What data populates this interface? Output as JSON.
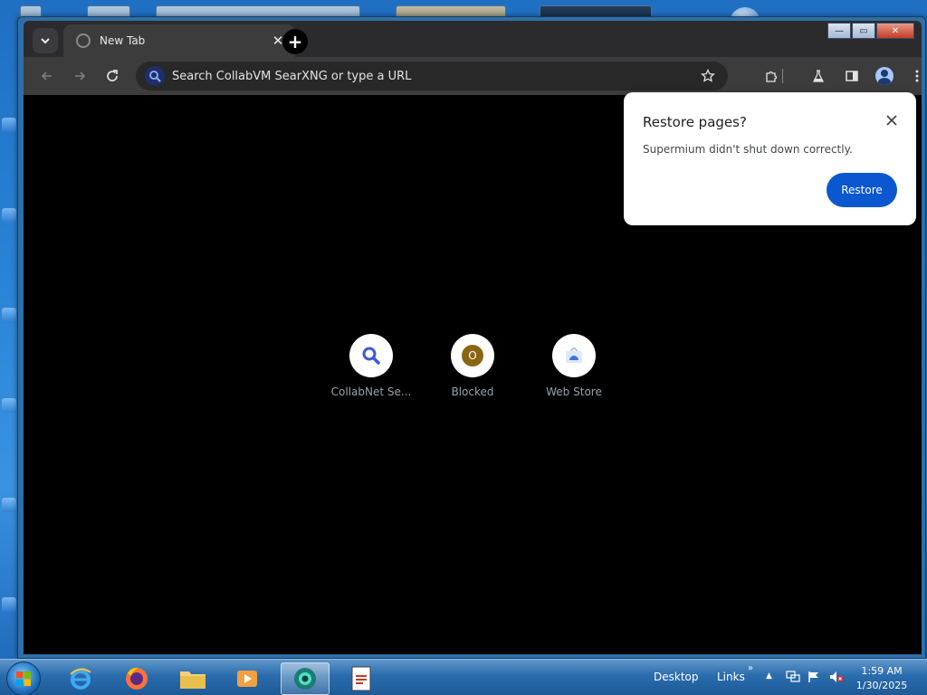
{
  "browser": {
    "tab": {
      "title": "New Tab"
    },
    "omnibox": {
      "placeholder": "Search CollabVM SearXNG or type a URL"
    },
    "shortcuts": [
      {
        "label": "CollabNet Se...",
        "icon": "magnifier-icon"
      },
      {
        "label": "Blocked",
        "icon": "blocked-site-icon",
        "letter": "O"
      },
      {
        "label": "Web Store",
        "icon": "web-store-icon"
      }
    ]
  },
  "popup": {
    "title": "Restore pages?",
    "message": "Supermium didn't shut down correctly.",
    "restore_label": "Restore"
  },
  "taskbar": {
    "desktop_label": "Desktop",
    "links_label": "Links",
    "time": "1:59 AM",
    "date": "1/30/2025"
  },
  "colors": {
    "accent": "#0b57d0",
    "tab_bg": "#3c3c3c",
    "content_bg": "#000000"
  }
}
